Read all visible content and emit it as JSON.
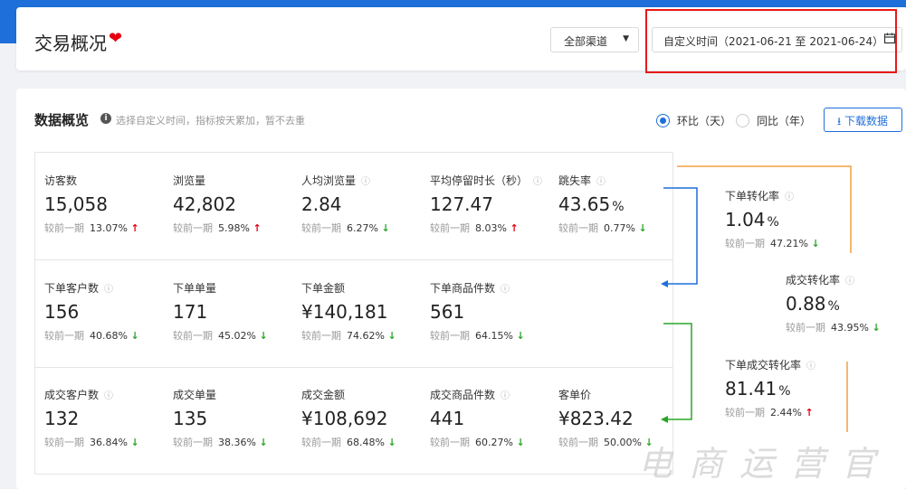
{
  "header": {
    "title": "交易概况",
    "channel_select": "全部渠道",
    "date_range": "自定义时间（2021-06-21 至 2021-06-24）"
  },
  "overview": {
    "title": "数据概览",
    "note": "选择自定义时间，指标按天累加，暂不去重",
    "radio_ring": "环比（天）",
    "radio_yoy": "同比（年）",
    "download": "下载数据",
    "compare_label": "较前一期"
  },
  "metrics": [
    {
      "label": "访客数",
      "help": false,
      "value": "15,058",
      "unit": "",
      "pct": "13.07%",
      "dir": "up"
    },
    {
      "label": "浏览量",
      "help": false,
      "value": "42,802",
      "unit": "",
      "pct": "5.98%",
      "dir": "up"
    },
    {
      "label": "人均浏览量",
      "help": true,
      "value": "2.84",
      "unit": "",
      "pct": "6.27%",
      "dir": "down"
    },
    {
      "label": "平均停留时长（秒）",
      "help": true,
      "value": "127.47",
      "unit": "",
      "pct": "8.03%",
      "dir": "up"
    },
    {
      "label": "跳失率",
      "help": true,
      "value": "43.65",
      "unit": "%",
      "pct": "0.77%",
      "dir": "down"
    },
    {
      "label": "下单客户数",
      "help": true,
      "value": "156",
      "unit": "",
      "pct": "40.68%",
      "dir": "down"
    },
    {
      "label": "下单单量",
      "help": false,
      "value": "171",
      "unit": "",
      "pct": "45.02%",
      "dir": "down"
    },
    {
      "label": "下单金额",
      "help": false,
      "value": "¥140,181",
      "unit": "",
      "pct": "74.62%",
      "dir": "down"
    },
    {
      "label": "下单商品件数",
      "help": true,
      "value": "561",
      "unit": "",
      "pct": "64.15%",
      "dir": "down"
    },
    {
      "label": "成交客户数",
      "help": true,
      "value": "132",
      "unit": "",
      "pct": "36.84%",
      "dir": "down"
    },
    {
      "label": "成交单量",
      "help": false,
      "value": "135",
      "unit": "",
      "pct": "38.36%",
      "dir": "down"
    },
    {
      "label": "成交金额",
      "help": false,
      "value": "¥108,692",
      "unit": "",
      "pct": "68.48%",
      "dir": "down"
    },
    {
      "label": "成交商品件数",
      "help": true,
      "value": "441",
      "unit": "",
      "pct": "60.27%",
      "dir": "down"
    },
    {
      "label": "客单价",
      "help": false,
      "value": "¥823.42",
      "unit": "",
      "pct": "50.00%",
      "dir": "down"
    }
  ],
  "conversions": [
    {
      "label": "下单转化率",
      "value": "1.04",
      "unit": "%",
      "pct": "47.21%",
      "dir": "down"
    },
    {
      "label": "成交转化率",
      "value": "0.88",
      "unit": "%",
      "pct": "43.95%",
      "dir": "down"
    },
    {
      "label": "下单成交转化率",
      "value": "81.41",
      "unit": "%",
      "pct": "2.44%",
      "dir": "up"
    }
  ],
  "colors": {
    "accent": "#1e6fd9",
    "up": "#e60012",
    "down": "#2aa52a",
    "highlight": "#e81919",
    "flow_orange": "#f0a040",
    "flow_blue": "#1e6fd9",
    "flow_green": "#2aa52a"
  },
  "watermark": "电商运营官"
}
